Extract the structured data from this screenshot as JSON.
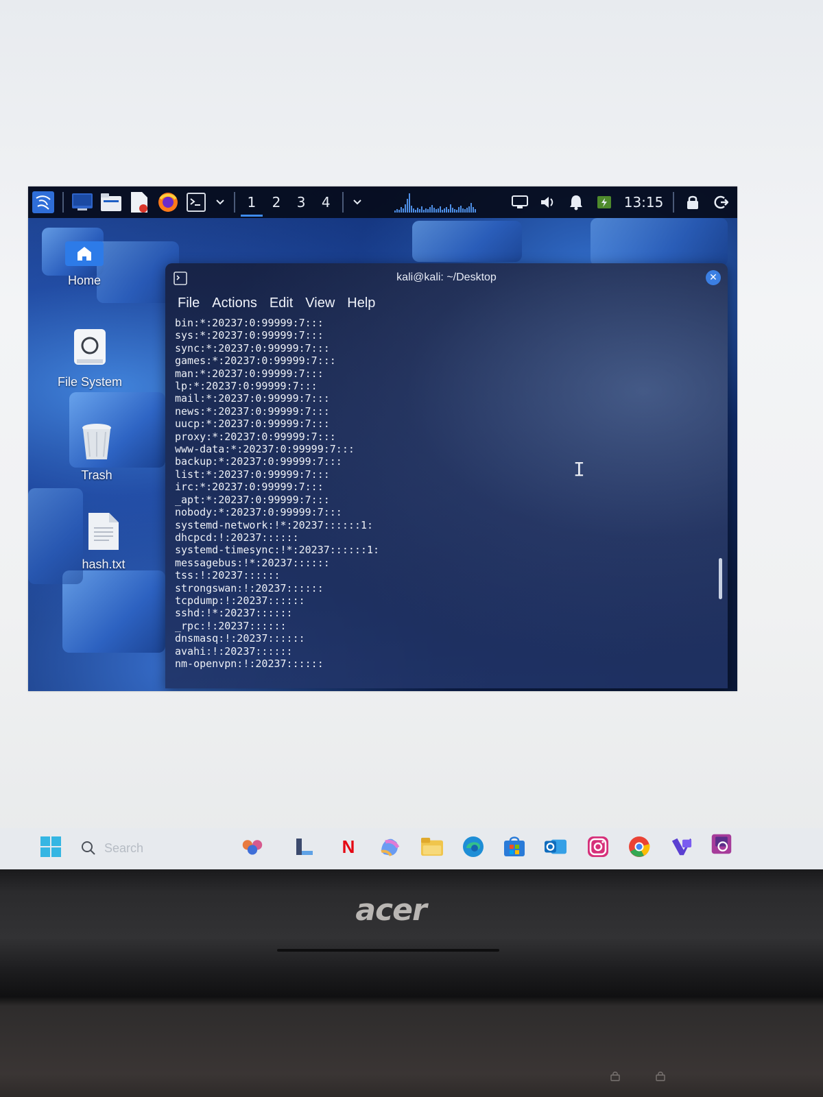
{
  "kali": {
    "panel": {
      "workspaces": [
        "1",
        "2",
        "3",
        "4"
      ],
      "active_workspace": "1",
      "clock": "13:15",
      "icons": [
        "kali-dragon-icon",
        "show-desktop-icon",
        "file-manager-icon",
        "text-editor-icon",
        "firefox-icon",
        "terminal-icon",
        "chevron-down-icon",
        "chevron-down-icon",
        "display-icon",
        "volume-icon",
        "bell-icon",
        "battery-icon",
        "lock-icon",
        "logout-icon"
      ]
    },
    "desktop_icons": [
      {
        "label": "Home",
        "icon": "home-folder-icon"
      },
      {
        "label": "File System",
        "icon": "drive-icon"
      },
      {
        "label": "Trash",
        "icon": "trash-icon"
      },
      {
        "label": "hash.txt",
        "icon": "text-file-icon"
      }
    ],
    "terminal": {
      "title": "kali@kali: ~/Desktop",
      "menu": [
        "File",
        "Actions",
        "Edit",
        "View",
        "Help"
      ],
      "lines": [
        "bin:*:20237:0:99999:7:::",
        "sys:*:20237:0:99999:7:::",
        "sync:*:20237:0:99999:7:::",
        "games:*:20237:0:99999:7:::",
        "man:*:20237:0:99999:7:::",
        "lp:*:20237:0:99999:7:::",
        "mail:*:20237:0:99999:7:::",
        "news:*:20237:0:99999:7:::",
        "uucp:*:20237:0:99999:7:::",
        "proxy:*:20237:0:99999:7:::",
        "www-data:*:20237:0:99999:7:::",
        "backup:*:20237:0:99999:7:::",
        "list:*:20237:0:99999:7:::",
        "irc:*:20237:0:99999:7:::",
        "_apt:*:20237:0:99999:7:::",
        "nobody:*:20237:0:99999:7:::",
        "systemd-network:!*:20237::::::1:",
        "dhcpcd:!:20237::::::",
        "systemd-timesync:!*:20237::::::1:",
        "messagebus:!*:20237::::::",
        "tss:!:20237::::::",
        "strongswan:!:20237::::::",
        "tcpdump:!:20237::::::",
        "sshd:!*:20237::::::",
        "_rpc:!:20237::::::",
        "dnsmasq:!:20237::::::",
        "avahi:!:20237::::::",
        "nm-openvpn:!:20237::::::"
      ]
    }
  },
  "windows": {
    "search_placeholder": "Search",
    "taskbar_icons": [
      "windows-start-icon",
      "search-icon",
      "copilot-people-icon",
      "l-app-icon",
      "netflix-icon",
      "copilot-icon",
      "file-explorer-icon",
      "edge-icon",
      "store-icon",
      "outlook-icon",
      "instagram-icon",
      "chrome-icon",
      "vs-icon",
      "virtualbox-icon"
    ],
    "netflix_letter": "N"
  },
  "laptop": {
    "brand": "acer"
  },
  "colors": {
    "kali_accent": "#3f8cf0",
    "terminal_bg": "#1c284e",
    "panel_bg": "#060c1c"
  }
}
